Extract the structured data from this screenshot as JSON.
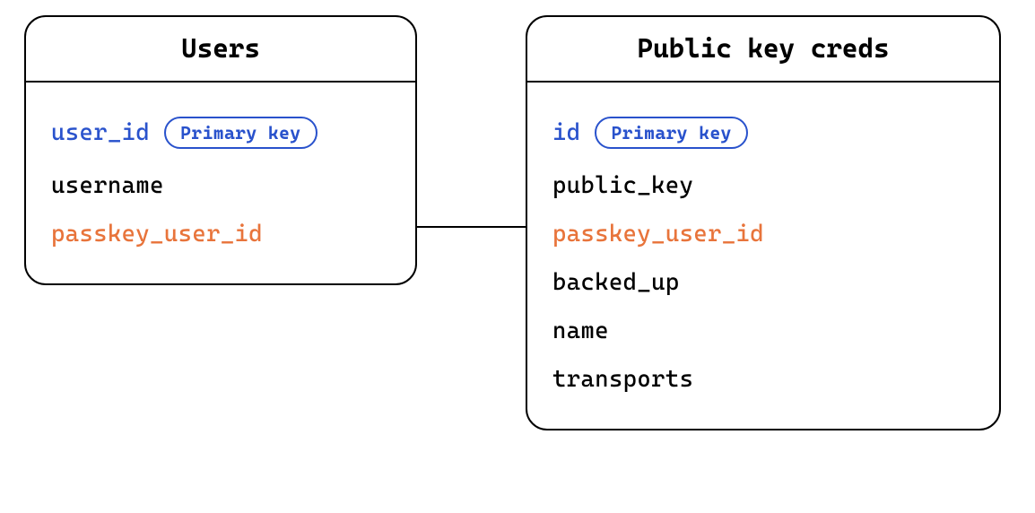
{
  "entities": {
    "users": {
      "title": "Users",
      "fields": [
        {
          "name": "user_id",
          "color": "blue",
          "primary_key": true
        },
        {
          "name": "username",
          "color": "black",
          "primary_key": false
        },
        {
          "name": "passkey_user_id",
          "color": "orange",
          "primary_key": false
        }
      ]
    },
    "creds": {
      "title": "Public key creds",
      "fields": [
        {
          "name": "id",
          "color": "blue",
          "primary_key": true
        },
        {
          "name": "public_key",
          "color": "black",
          "primary_key": false
        },
        {
          "name": "passkey_user_id",
          "color": "orange",
          "primary_key": false
        },
        {
          "name": "backed_up",
          "color": "black",
          "primary_key": false
        },
        {
          "name": "name",
          "color": "black",
          "primary_key": false
        },
        {
          "name": "transports",
          "color": "black",
          "primary_key": false
        }
      ]
    }
  },
  "badges": {
    "primary_key_label": "Primary key"
  },
  "relationship": {
    "from": "users.passkey_user_id",
    "to": "creds.passkey_user_id"
  }
}
